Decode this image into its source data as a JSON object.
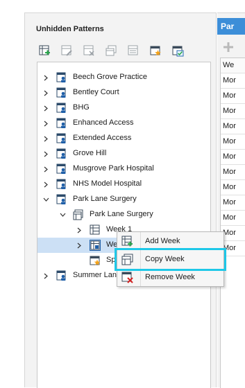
{
  "panel": {
    "title": "Unhidden Patterns"
  },
  "toolbar": {
    "icons": [
      "add-pattern-icon",
      "edit-pattern-icon",
      "delete-pattern-icon",
      "copy-pattern-icon",
      "pattern-properties-icon",
      "schedule-star-icon",
      "schedule-check-icon"
    ]
  },
  "tree": {
    "items": [
      {
        "label": "Beech Grove Practice"
      },
      {
        "label": "Bentley Court"
      },
      {
        "label": "BHG"
      },
      {
        "label": "Enhanced Access"
      },
      {
        "label": "Extended Access"
      },
      {
        "label": "Grove Hill"
      },
      {
        "label": "Musgrove Park Hospital"
      },
      {
        "label": "NHS Model Hospital"
      },
      {
        "label": "Park Lane Surgery"
      },
      {
        "label": "Park Lane Surgery"
      },
      {
        "label": "Week 1"
      },
      {
        "label": "We"
      },
      {
        "label": "Sp"
      },
      {
        "label": "Summer Lane"
      }
    ]
  },
  "right_panel": {
    "tab_label": "Par",
    "column_header": "We",
    "rows": [
      "Mor",
      "Mor",
      "Mor",
      "Mor",
      "Mor",
      "Mor",
      "Mor",
      "Mor",
      "Mor",
      "Mor",
      "Mor",
      "Mor"
    ]
  },
  "context_menu": {
    "items": [
      {
        "label": "Add Week",
        "icon": "add-week-icon"
      },
      {
        "label": "Copy Week",
        "icon": "copy-week-icon"
      },
      {
        "label": "Remove Week",
        "icon": "remove-week-icon"
      }
    ]
  },
  "colors": {
    "tab_blue": "#3c8ed8",
    "selection": "#cce0f5",
    "highlight": "#1ec8e8",
    "delete_red": "#d42020",
    "add_green": "#2aa84a",
    "star_orange": "#f5a31a"
  }
}
